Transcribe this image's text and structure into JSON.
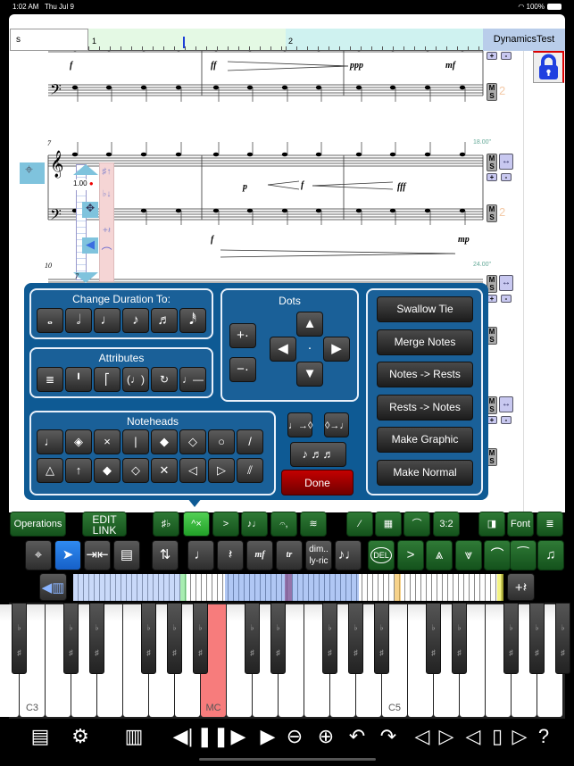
{
  "status": {
    "time": "1:02 AM",
    "date": "Thu Jul 9",
    "battery": "100%"
  },
  "header": {
    "search_value": "s",
    "title": "DynamicsTest",
    "ruler_marks": [
      "1",
      "2"
    ]
  },
  "score": {
    "system1": {
      "dynamics": [
        "f",
        "ff",
        "ppp",
        "mf"
      ],
      "part_number": "2"
    },
    "system2": {
      "measure": "7",
      "tempo": "18.00\"",
      "dynamics_mid": [
        "p",
        "f",
        "fff"
      ],
      "dynamics_low": [
        "f",
        "mp"
      ],
      "part_number": "2",
      "note_value": "1.00",
      "tool_measure": "7"
    },
    "system3": {
      "measure": "10",
      "tempo": "24.00\""
    },
    "buttons": {
      "mute": "M",
      "solo": "S",
      "plus": "+",
      "minus": "-"
    }
  },
  "popup": {
    "duration": {
      "title": "Change Duration To:",
      "icons": [
        "whole-note-icon",
        "half-note-icon",
        "quarter-note-icon",
        "eighth-note-icon",
        "sixteenth-note-icon",
        "thirty-second-note-icon"
      ]
    },
    "attributes": {
      "title": "Attributes",
      "icons": [
        "ledger-lines-icon",
        "stem-up-icon",
        "flag-icon",
        "parenthesized-note-icon",
        "cue-note-icon",
        "tied-note-icon"
      ]
    },
    "noteheads": {
      "title": "Noteheads",
      "icons": [
        "normal-head-icon",
        "slash-diamond-head-icon",
        "x-head-icon",
        "no-head-icon",
        "diamond-filled-head-icon",
        "diamond-open-head-icon",
        "open-head-icon",
        "slash-head-icon",
        "triangle-up-open-icon",
        "arrow-up-head-icon",
        "diamond-small-filled-icon",
        "diamond-small-open-icon",
        "cross-head-icon",
        "triangle-left-icon",
        "triangle-right-icon",
        "slash-open-icon"
      ]
    },
    "dots": {
      "title": "Dots",
      "add": "+·",
      "remove": "−·",
      "center": "·"
    },
    "actions": [
      "Swallow Tie",
      "Merge Notes",
      "Notes -> Rests",
      "Rests -> Notes",
      "Make Graphic",
      "Make Normal"
    ],
    "done": "Done"
  },
  "toolbar": {
    "operations": "Operations",
    "edit_link_1": "EDIT",
    "edit_link_2": "LINK",
    "font": "Font",
    "dim": "dim..",
    "lyric": "ly-ric",
    "tr": "tr",
    "del": "DEL",
    "mf": "mf"
  },
  "piano": {
    "labels": {
      "c3": "C3",
      "mc": "MC",
      "c5": "C5"
    },
    "highlight": "#f77c7c"
  },
  "colors": {
    "popup": "#0e5a94",
    "toolbar_green": "#1f6a28",
    "selected_blue": "#1f74e0",
    "done_red": "#a00000"
  }
}
